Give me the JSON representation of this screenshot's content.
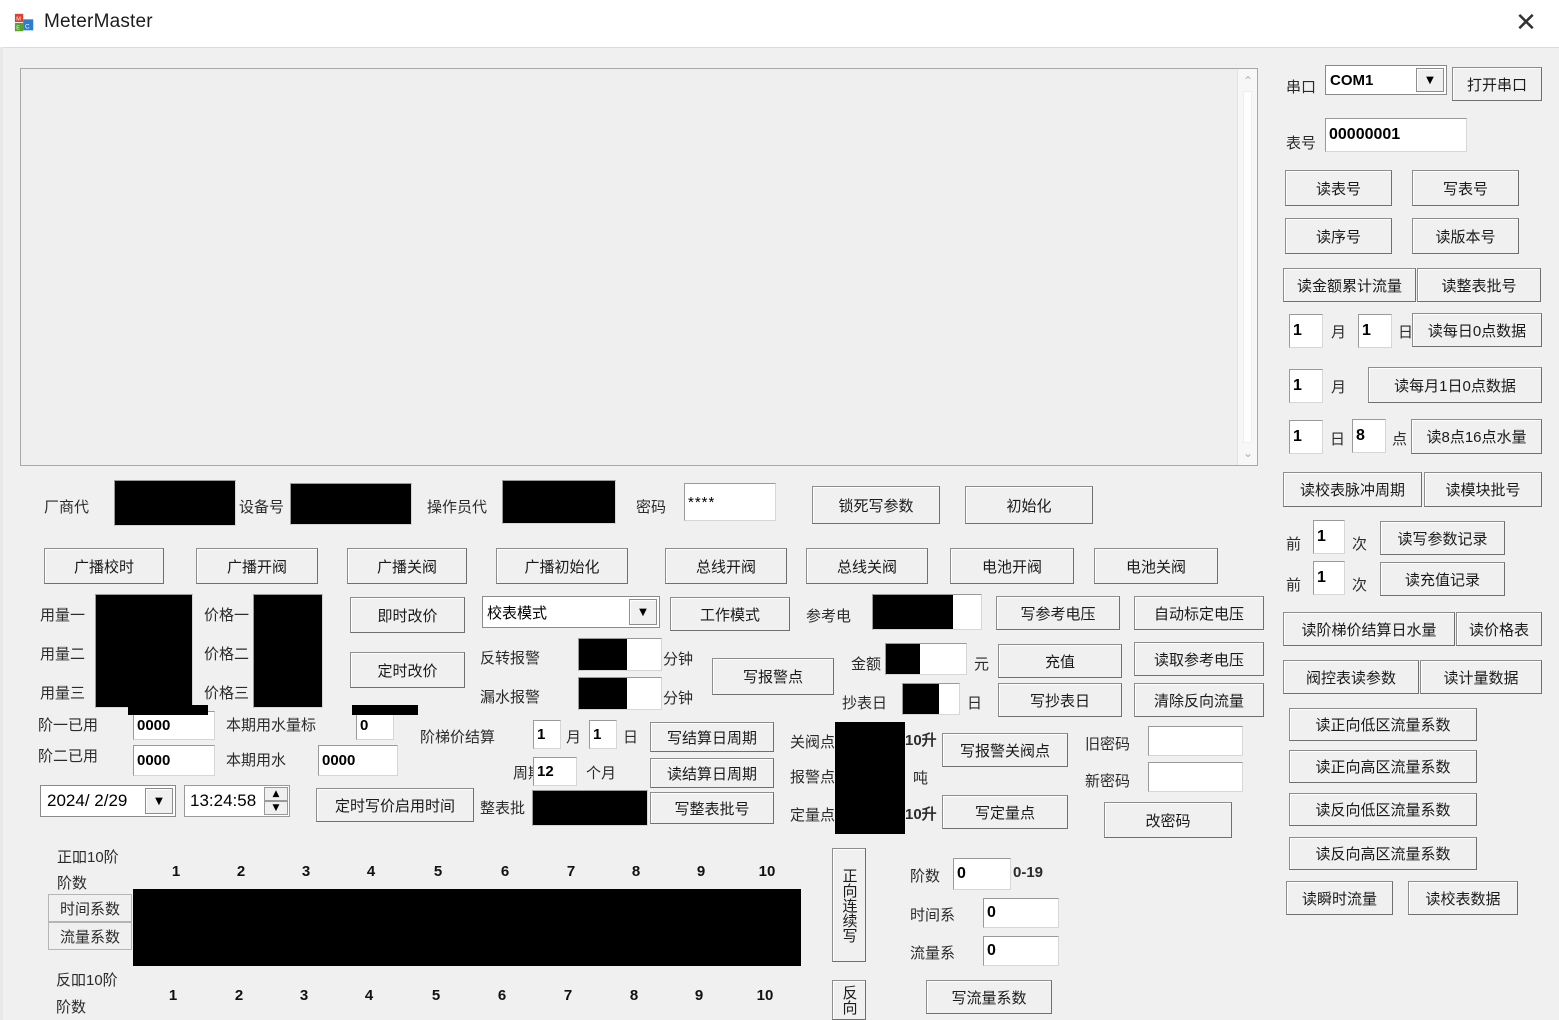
{
  "window": {
    "title": "MeterMaster",
    "close_label": "✕",
    "app_icon": "app-blocks-icon"
  },
  "display_pane": {
    "content": "",
    "scroll_up": "⌃",
    "scroll_down": "⌄"
  },
  "serial": {
    "port_label": "串口",
    "port_value": "COM1",
    "open_button": "打开串口",
    "meter_no_label": "表号",
    "meter_no_value": "00000001"
  },
  "right_buttons": {
    "read_meter_no": "读表号",
    "write_meter_no": "写表号",
    "read_serial_no": "读序号",
    "read_version": "读版本号",
    "read_amount_total_flow": "读金额累计流量",
    "read_meter_batch": "读整表批号",
    "read_daily_0h": "读每日0点数据",
    "read_monthly_1d_0h": "读每月1日0点数据",
    "read_8h_16h_water": "读8点16点水量",
    "read_calib_pulse_cycle": "读校表脉冲周期",
    "read_module_batch": "读模块批号",
    "read_write_param_log": "读写参数记录",
    "read_recharge_log": "读充值记录",
    "read_tier_settle_water": "读阶梯价结算日水量",
    "read_price_table": "读价格表",
    "read_valve_meter_param": "阀控表读参数",
    "read_metering_data": "读计量数据",
    "read_fwd_low_coef": "读正向低区流量系数",
    "read_fwd_high_coef": "读正向高区流量系数",
    "read_rev_low_coef": "读反向低区流量系数",
    "read_rev_high_coef": "读反向高区流量系数",
    "read_instant_flow": "读瞬时流量",
    "read_calib_data": "读校表数据"
  },
  "date_inputs": {
    "daily_month": "1",
    "daily_month_unit": "月",
    "daily_day": "1",
    "daily_day_unit": "日",
    "monthly_month": "1",
    "monthly_month_unit": "月",
    "hour_day": "1",
    "hour_day_unit": "日",
    "hour_value": "8",
    "hour_unit": "点",
    "prev_label": "前",
    "times_label": "次",
    "param_times": "1",
    "recharge_times": "1"
  },
  "credentials": {
    "vendor_label": "厂商代",
    "vendor_value": "",
    "device_label": "设备号",
    "device_value": "",
    "operator_label": "操作员代",
    "operator_value": "",
    "password_label": "密码",
    "password_value": "****",
    "lock_write_param": "锁死写参数",
    "initialize": "初始化"
  },
  "broadcast_row": {
    "sync_time": "广播校时",
    "open_valve": "广播开阀",
    "close_valve": "广播关阀",
    "init": "广播初始化",
    "bus_open_valve": "总线开阀",
    "bus_close_valve": "总线关阀",
    "battery_open_valve": "电池开阀",
    "battery_close_valve": "电池关阀"
  },
  "price_block": {
    "usage1_label": "用量一",
    "usage2_label": "用量二",
    "usage3_label": "用量三",
    "price1_label": "价格一",
    "price2_label": "价格二",
    "price3_label": "价格三",
    "instant_change_price": "即时改价",
    "timed_change_price": "定时改价",
    "mode_value": "校表模式",
    "work_mode_button": "工作模式",
    "reverse_alarm_label": "反转报警",
    "leak_alarm_label": "漏水报警",
    "minute_unit": "分钟",
    "write_alarm_point": "写报警点"
  },
  "voltage_block": {
    "ref_voltage_label": "参考电",
    "write_ref_voltage": "写参考电压",
    "auto_calib_voltage": "自动标定电压",
    "amount_label": "金额",
    "yuan_unit": "元",
    "recharge_button": "充值",
    "read_ref_voltage": "读取参考电压",
    "meter_read_day_label": "抄表日",
    "day_unit": "日",
    "write_meter_read_day": "写抄表日",
    "clear_reverse_flow": "清除反向流量"
  },
  "tier_block": {
    "tier1_used_label": "阶一已用",
    "tier1_used_value": "0000",
    "tier2_used_label": "阶二已用",
    "tier2_used_value": "0000",
    "period_water_std_label": "本期用水量标",
    "period_water_std_value": "0",
    "period_water_label": "本期用水",
    "period_water_value": "0000",
    "settle_label": "阶梯价结算",
    "settle_month": "1",
    "settle_month_unit": "月",
    "settle_day": "1",
    "settle_day_unit": "日",
    "write_settle_cycle": "写结算日周期",
    "cycle_label": "周期",
    "cycle_value": "12",
    "cycle_unit": "个月",
    "read_settle_cycle": "读结算日周期",
    "batch_label": "整表批",
    "write_batch": "写整表批号",
    "datetime_date": "2024/ 2/29",
    "datetime_time": "13:24:58",
    "timed_price_start": "定时写价启用时间"
  },
  "valve_points": {
    "close_valve_point_label": "关阀点",
    "close_valve_unit": "10升",
    "alarm_point_label": "报警点",
    "alarm_unit": "吨",
    "quantitative_point_label": "定量点",
    "quantitative_unit": "10升",
    "write_alarm_close_point": "写报警关阀点",
    "write_quantitative_point": "写定量点"
  },
  "password_block": {
    "old_label": "旧密码",
    "old_value": "",
    "new_label": "新密码",
    "new_value": "",
    "change_button": "改密码"
  },
  "coef_grid": {
    "forward_title_line1": "正吅10阶",
    "forward_title_line2": "阶数",
    "reverse_title_line1": "反吅10阶",
    "reverse_title_line2": "阶数",
    "time_coef_label": "时间系数",
    "flow_coef_label": "流量系数",
    "columns": [
      "1",
      "2",
      "3",
      "4",
      "5",
      "6",
      "7",
      "8",
      "9",
      "10"
    ],
    "forward_write_button": "正向连续写",
    "reverse_write_button": "反向"
  },
  "coef_edit": {
    "order_label": "阶数",
    "order_value": "0",
    "order_range": "0-19",
    "time_coef_label": "时间系",
    "time_coef_value": "0",
    "flow_coef_label": "流量系",
    "flow_coef_value": "0",
    "write_flow_coef": "写流量系数"
  }
}
